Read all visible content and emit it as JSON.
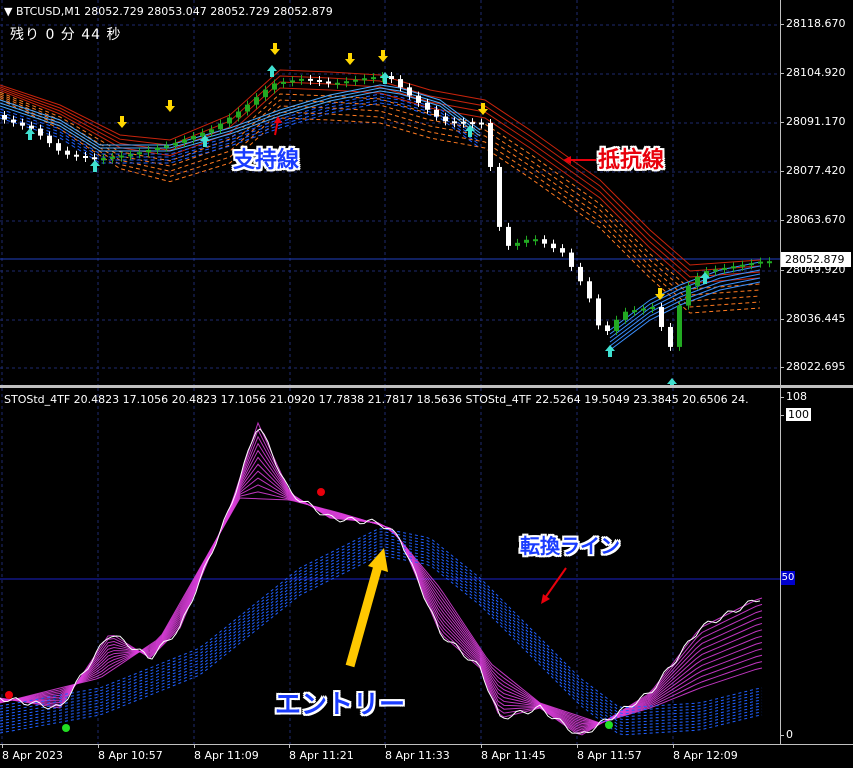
{
  "price_chart": {
    "header": "BTCUSD,M1  28052.729 28053.047 28052.729 28052.879",
    "timer": "残り 0 分 44 秒",
    "price_ticks": [
      "28118.670",
      "28104.920",
      "28091.170",
      "28077.420",
      "28063.670",
      "28049.920",
      "28036.445",
      "28022.695"
    ],
    "current_price": "28052.879",
    "label_support": "支持線",
    "label_resistance": "抵抗線",
    "colors": {
      "support": "#1e90ff",
      "resistance": "#c0180c",
      "bull": "#22aa22",
      "bear": "#ffffff",
      "up_arrow": "#40e0d0",
      "down_arrow": "#ffd700"
    }
  },
  "oscillator": {
    "header": "STOStd_4TF 20.4823 17.1056 20.4823 17.1056 21.0920 17.7838 21.7817 18.5636  STOStd_4TF 22.5264 19.5049 23.3845 20.6506 24.",
    "ticks": [
      "108",
      "100",
      "50",
      "0"
    ],
    "label_turn": "転換ライン",
    "label_entry": "エントリー",
    "colors": {
      "magenta": "#e040e0",
      "blue": "#2060ff",
      "white": "#ffffff",
      "entry_arrow": "#ffc800"
    }
  },
  "time_axis": [
    "8 Apr 2023",
    "8 Apr 10:57",
    "8 Apr 11:09",
    "8 Apr 11:21",
    "8 Apr 11:33",
    "8 Apr 11:45",
    "8 Apr 11:57",
    "8 Apr 12:09"
  ]
}
